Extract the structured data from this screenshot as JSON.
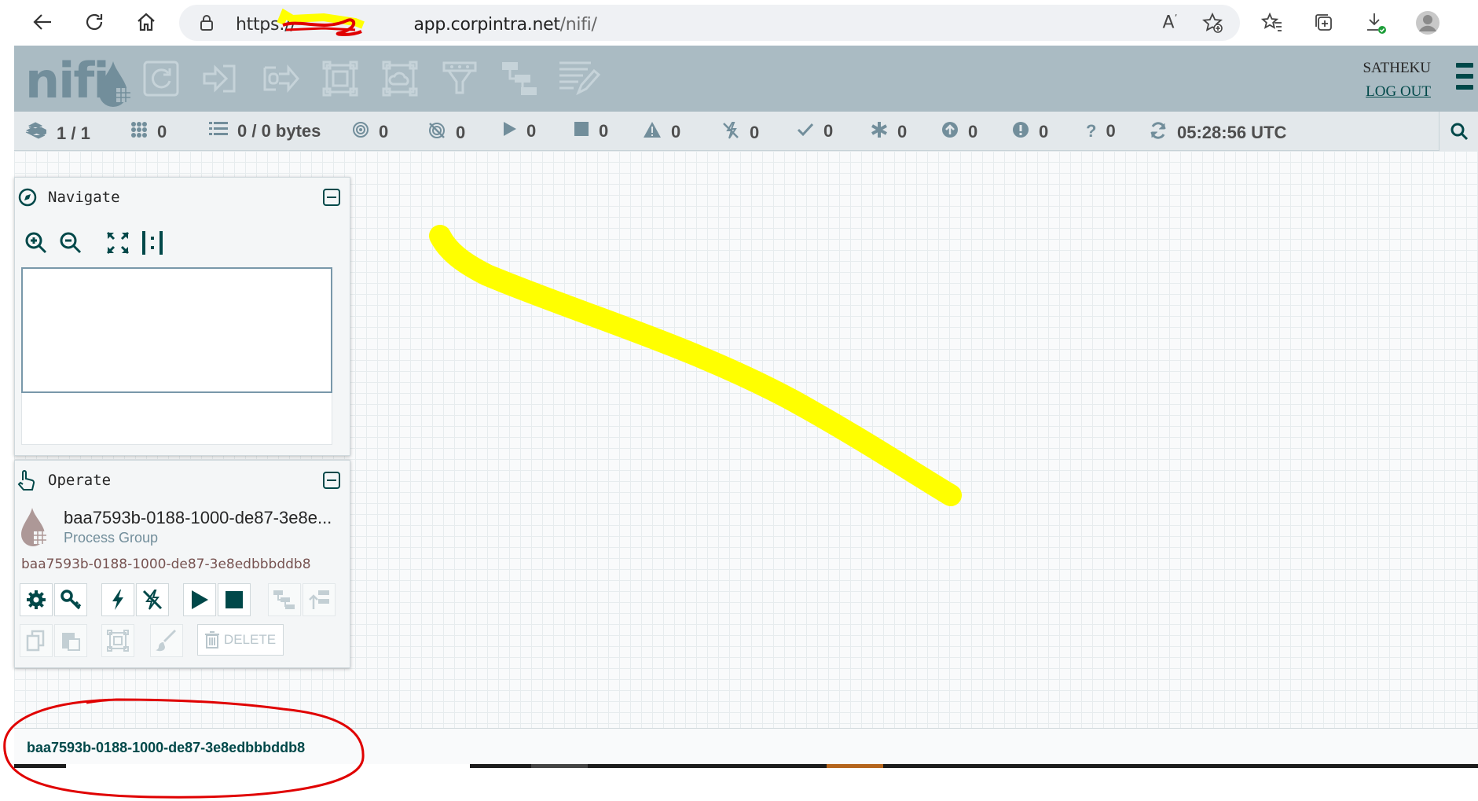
{
  "browser": {
    "url_scheme": "https://",
    "url_host": "app.corpintra.net",
    "url_path": "/nifi/"
  },
  "header": {
    "logo": "nifi",
    "user": "SATHEKU",
    "logout": "LOG OUT",
    "components": [
      "processor-icon",
      "input-port-icon",
      "output-port-icon",
      "process-group-icon",
      "remote-process-group-icon",
      "funnel-icon",
      "template-icon",
      "label-icon"
    ]
  },
  "status": {
    "active_threads": "1 / 1",
    "total_queued": "0",
    "queued_bytes": "0 / 0 bytes",
    "transmitting": "0",
    "not_transmitting": "0",
    "running": "0",
    "stopped": "0",
    "invalid": "0",
    "disabled": "0",
    "up_to_date": "0",
    "locally_modified": "0",
    "stale": "0",
    "locally_modified_stale": "0",
    "sync_failure": "0",
    "last_refreshed": "05:28:56 UTC"
  },
  "navigate": {
    "title": "Navigate"
  },
  "operate": {
    "title": "Operate",
    "selection_name": "baa7593b-0188-1000-de87-3e8e...",
    "selection_type": "Process Group",
    "selection_id": "baa7593b-0188-1000-de87-3e8edbbbddb8",
    "delete_label": "DELETE"
  },
  "breadcrumb": {
    "current": "baa7593b-0188-1000-de87-3e8edbbbddb8"
  },
  "colors": {
    "header_bg": "#aabbc3",
    "status_bg": "#e3e8eb",
    "accent": "#004849",
    "annotation_yellow": "#ffff00",
    "annotation_red": "#e00000"
  }
}
